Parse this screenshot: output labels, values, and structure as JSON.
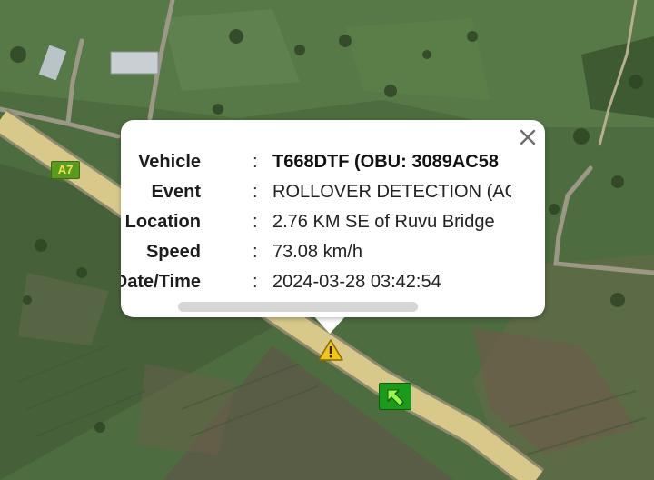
{
  "map": {
    "route_shield": "A7",
    "colors": {
      "road": "#d8c98a",
      "road_edge": "#8d8a6d",
      "warning": "#f3c515",
      "vehicle_marker": "#1c9a1a"
    },
    "markers": [
      {
        "name": "warning-marker",
        "icon": "warning-triangle-icon"
      },
      {
        "name": "vehicle-marker",
        "icon": "arrow-up-left-icon",
        "heading": "north-west"
      }
    ]
  },
  "popup": {
    "close_icon": "close-icon",
    "rows": [
      {
        "label": "Vehicle",
        "value": "T668DTF (OBU: 3089AC58"
      },
      {
        "label": "Event",
        "value": "ROLLOVER DETECTION (AC"
      },
      {
        "label": "Location",
        "value": "2.76 KM SE of Ruvu Bridge"
      },
      {
        "label": "Speed",
        "value": "73.08 km/h"
      },
      {
        "label": "Date/Time",
        "value": "2024-03-28 03:42:54"
      }
    ],
    "separator": ":"
  }
}
